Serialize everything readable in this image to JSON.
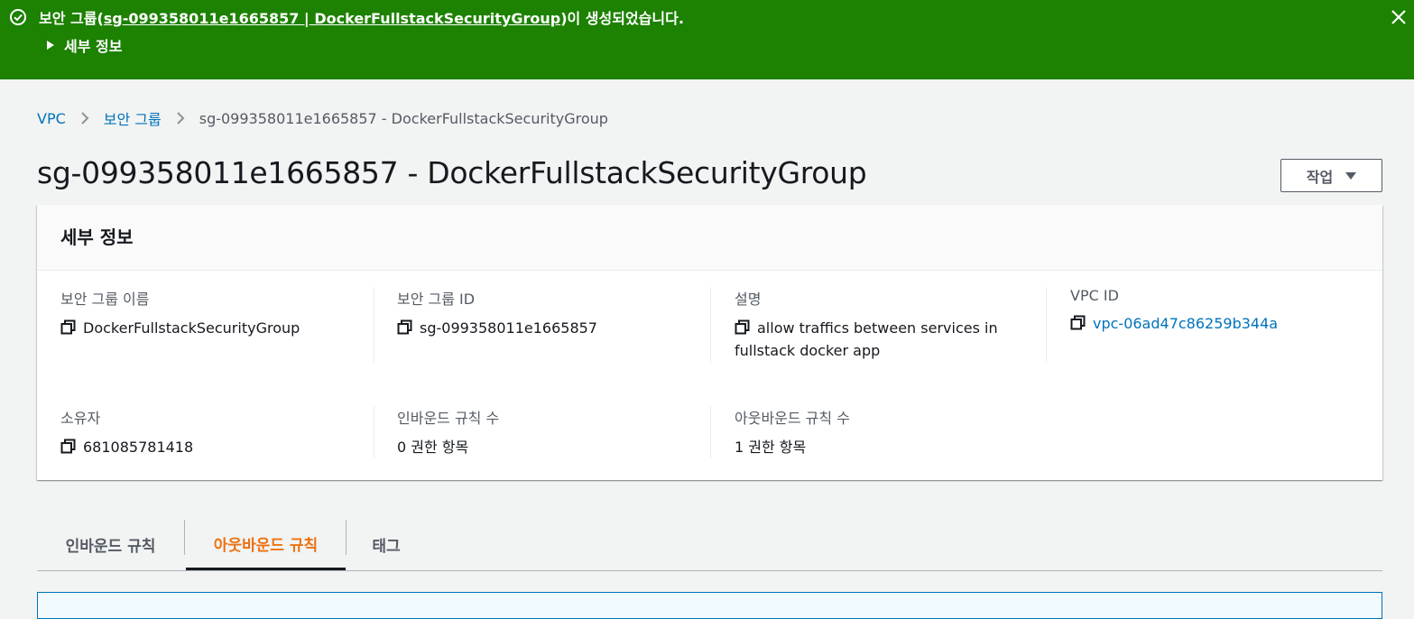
{
  "flash": {
    "prefix": "보안 그룹(",
    "link_text": "sg-099358011e1665857 | DockerFullstackSecurityGroup",
    "suffix": ")이 생성되었습니다.",
    "details_label": "세부 정보",
    "color": "#1d8102",
    "status_icon": "check-circle-icon",
    "close_icon": "close-icon"
  },
  "breadcrumb": {
    "items": [
      "VPC",
      "보안 그룹"
    ],
    "current": "sg-099358011e1665857 - DockerFullstackSecurityGroup"
  },
  "page": {
    "title": "sg-099358011e1665857 - DockerFullstackSecurityGroup",
    "actions_label": "작업"
  },
  "details": {
    "header": "세부 정보",
    "fields": {
      "name": {
        "label": "보안 그룹 이름",
        "value": "DockerFullstackSecurityGroup"
      },
      "id": {
        "label": "보안 그룹 ID",
        "value": "sg-099358011e1665857"
      },
      "description": {
        "label": "설명",
        "value": "allow traffics between services in fullstack docker app"
      },
      "vpc": {
        "label": "VPC ID",
        "value": "vpc-06ad47c86259b344a"
      },
      "owner": {
        "label": "소유자",
        "value": "681085781418"
      },
      "inbound_count": {
        "label": "인바운드 규칙 수",
        "value": "0 권한 항목"
      },
      "outbound_count": {
        "label": "아웃바운드 규칙 수",
        "value": "1 권한 항목"
      }
    }
  },
  "tabs": {
    "items": [
      "인바운드 규칙",
      "아웃바운드 규칙",
      "태그"
    ],
    "active": "아웃바운드 규칙",
    "active_color": "#ec7211"
  }
}
